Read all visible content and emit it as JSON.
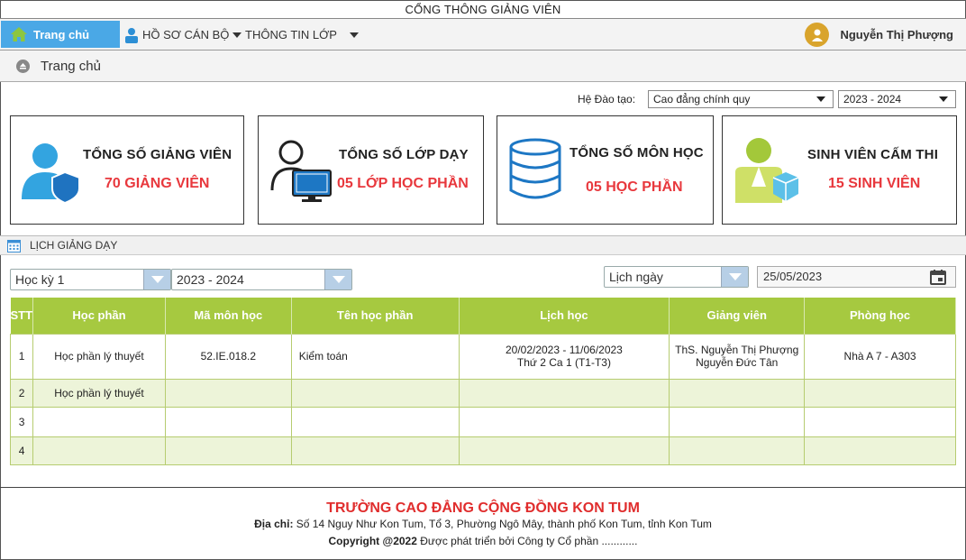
{
  "app_title": "CỔNG THÔNG GIẢNG VIÊN",
  "nav": {
    "home": "Trang chủ",
    "ho_so": "HỒ SƠ CÁN BỘ",
    "thong_tin_lop": "THÔNG TIN LỚP",
    "user_name": "Nguyễn Thị Phượng"
  },
  "breadcrumb": "Trang chủ",
  "filters": {
    "label": "Hệ Đào tạo:",
    "program": "Cao đẳng chính quy",
    "year": "2023 - 2024"
  },
  "cards": [
    {
      "title": "TỔNG SỐ GIẢNG VIÊN",
      "value": "70 GIẢNG VIÊN",
      "icon": "teacher-shield-icon"
    },
    {
      "title": "TỔNG SỐ LỚP DẠY",
      "value": "05 LỚP HỌC PHẦN",
      "icon": "computer-user-icon"
    },
    {
      "title": "TỔNG SỐ MÔN HỌC",
      "value": "05 HỌC PHẦN",
      "icon": "database-icon"
    },
    {
      "title": "SINH VIÊN CẤM THI",
      "value": "15 SINH VIÊN",
      "icon": "student-box-icon"
    }
  ],
  "schedule": {
    "section_title": "LỊCH GIẢNG DẠY",
    "semester": "Học kỳ 1",
    "year": "2023 - 2024",
    "view": "Lịch ngày",
    "date": "25/05/2023",
    "columns": [
      "STT",
      "Học phần",
      "Mã môn học",
      "Tên học phần",
      "Lịch học",
      "Giảng viên",
      "Phòng học"
    ],
    "rows": [
      {
        "stt": "1",
        "hoc_phan": "Học phần lý thuyết",
        "ma": "52.IE.018.2",
        "ten": "Kiểm toán",
        "lich_1": "20/02/2023 - 11/06/2023",
        "lich_2": "Thứ 2 Ca 1 (T1-T3)",
        "gv_1": "ThS. Nguyễn Thị Phượng",
        "gv_2": "Nguyễn Đức Tân",
        "phong": "Nhà A 7 - A303"
      },
      {
        "stt": "2",
        "hoc_phan": "Học phần lý thuyết",
        "ma": "",
        "ten": "",
        "lich_1": "",
        "lich_2": "",
        "gv_1": "",
        "gv_2": "",
        "phong": ""
      },
      {
        "stt": "3",
        "hoc_phan": "",
        "ma": "",
        "ten": "",
        "lich_1": "",
        "lich_2": "",
        "gv_1": "",
        "gv_2": "",
        "phong": ""
      },
      {
        "stt": "4",
        "hoc_phan": "",
        "ma": "",
        "ten": "",
        "lich_1": "",
        "lich_2": "",
        "gv_1": "",
        "gv_2": "",
        "phong": ""
      }
    ]
  },
  "footer": {
    "school": "TRƯỜNG CAO ĐẲNG CỘNG ĐỒNG KON TUM",
    "address_label": "Địa chỉ:",
    "address": "Số 14 Nguy Như Kon Tum, Tổ 3, Phường Ngô Mây, thành phố Kon Tum, tỉnh Kon Tum",
    "copyright_label": "Copyright @2022",
    "copyright_text": "Được phát triển bởi Công ty Cổ phần ............"
  },
  "colors": {
    "accent": "#4aa8e6",
    "table_header": "#a6c940",
    "value_red": "#e8383d"
  }
}
